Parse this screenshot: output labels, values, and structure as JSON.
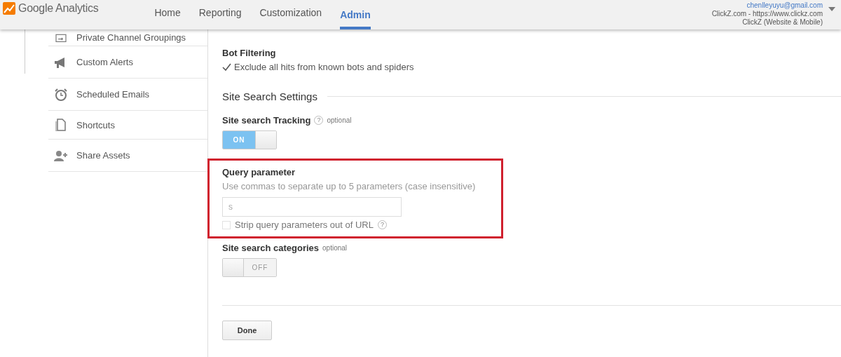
{
  "header": {
    "brand": "Google Analytics",
    "nav": [
      {
        "label": "Home",
        "selected": false
      },
      {
        "label": "Reporting",
        "selected": false
      },
      {
        "label": "Customization",
        "selected": false
      },
      {
        "label": "Admin",
        "selected": true
      }
    ],
    "account": {
      "email": "chenlleyuyu@gmail.com",
      "property": "ClickZ.com - https://www.clickz.com",
      "view": "ClickZ (Website & Mobile)"
    }
  },
  "sidebar": {
    "items": [
      {
        "kind": "channels",
        "label": "Private Channel Groupings"
      },
      {
        "kind": "alerts",
        "label": "Custom Alerts"
      },
      {
        "kind": "emails",
        "label": "Scheduled Emails"
      },
      {
        "kind": "shortcuts",
        "label": "Shortcuts"
      },
      {
        "kind": "share",
        "label": "Share Assets"
      }
    ]
  },
  "bot_filtering": {
    "title": "Bot Filtering",
    "option": {
      "label": "Exclude all hits from known bots and spiders",
      "checked": true
    }
  },
  "site_search": {
    "heading": "Site Search Settings",
    "tracking": {
      "label": "Site search Tracking",
      "help": "?",
      "note": "optional",
      "on": true,
      "text": "ON"
    },
    "query": {
      "label": "Query parameter",
      "hint": "Use commas to separate up to 5 parameters (case insensitive)",
      "placeholder": "s",
      "strip": {
        "label": "Strip query parameters out of URL",
        "help": "?",
        "checked": false
      }
    },
    "categories": {
      "label": "Site search categories",
      "note": "optional",
      "on": false,
      "text": "OFF"
    }
  },
  "buttons": [
    "Done"
  ]
}
